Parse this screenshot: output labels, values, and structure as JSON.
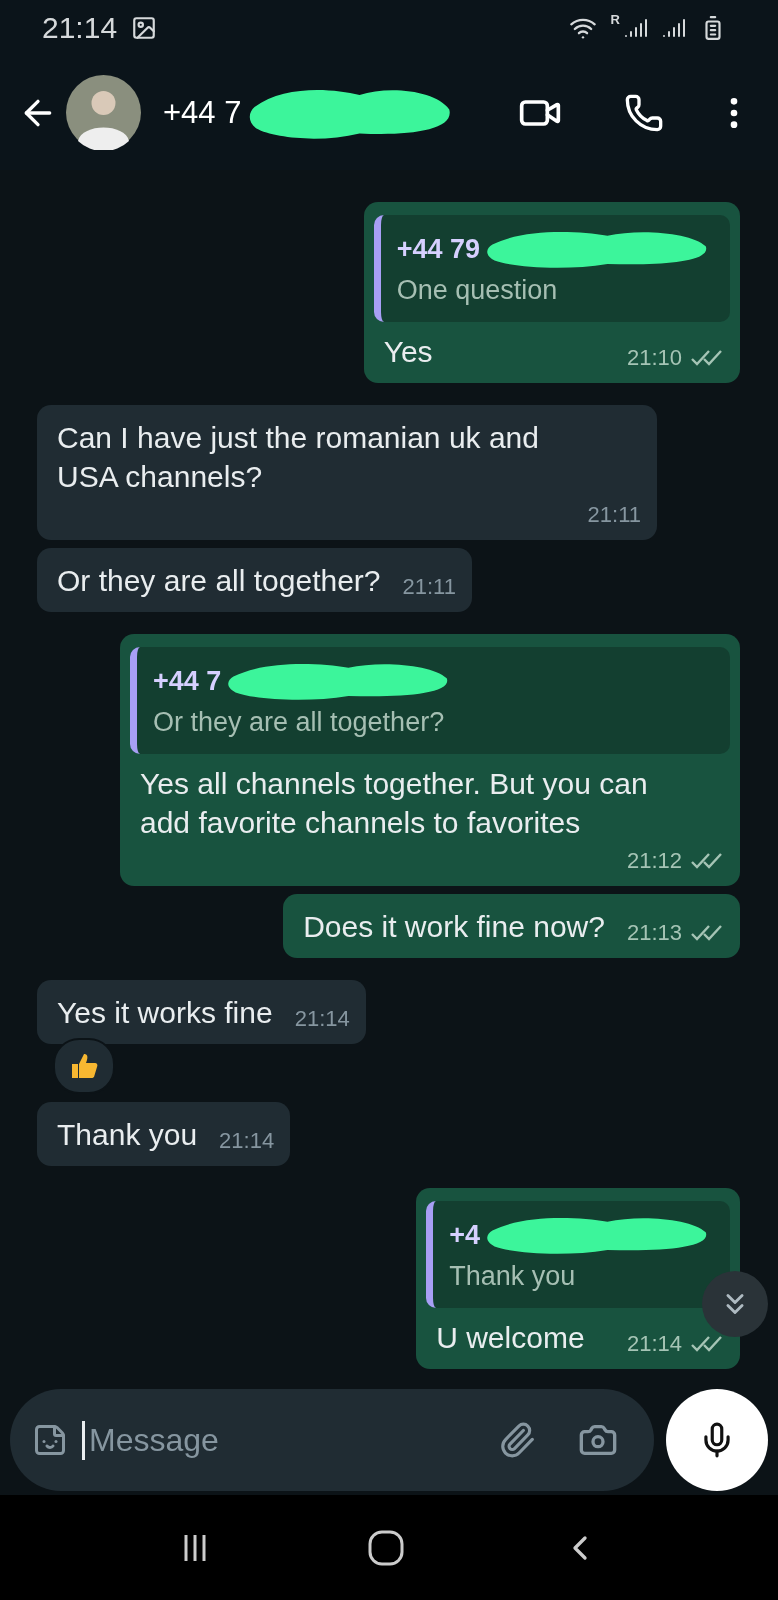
{
  "status_bar": {
    "time": "21:14",
    "roaming_mark": "R"
  },
  "header": {
    "contact": "+44 7",
    "redacted": true
  },
  "messages": [
    {
      "kind": "outgoing",
      "quote": {
        "author": "+44 79",
        "text": "One question",
        "redacted": true
      },
      "text": "Yes",
      "time": "21:10",
      "read": false,
      "reacted": false
    },
    {
      "kind": "incoming",
      "text": "Can I have just the romanian uk and USA channels?",
      "time": "21:11",
      "reacted": false
    },
    {
      "kind": "incoming",
      "text": "Or they are all together?",
      "time": "21:11",
      "reacted": false
    },
    {
      "kind": "outgoing",
      "quote": {
        "author": "+44 7",
        "text": "Or they are all together?",
        "redacted": true
      },
      "text": "Yes all channels together. But you can add favorite channels to favorites",
      "time": "21:12",
      "read": false,
      "reacted": false
    },
    {
      "kind": "outgoing",
      "text": "Does it work fine now?",
      "time": "21:13",
      "read": false,
      "reacted": false
    },
    {
      "kind": "incoming",
      "text": "Yes it works fine",
      "time": "21:14",
      "reacted": true
    },
    {
      "kind": "incoming",
      "text": "Thank you",
      "time": "21:14",
      "reacted": false
    },
    {
      "kind": "outgoing",
      "quote": {
        "author": "+4",
        "text": "Thank you",
        "redacted": true
      },
      "text": "U welcome",
      "time": "21:14",
      "read": false,
      "reacted": false
    }
  ],
  "composer": {
    "placeholder": "Message"
  }
}
